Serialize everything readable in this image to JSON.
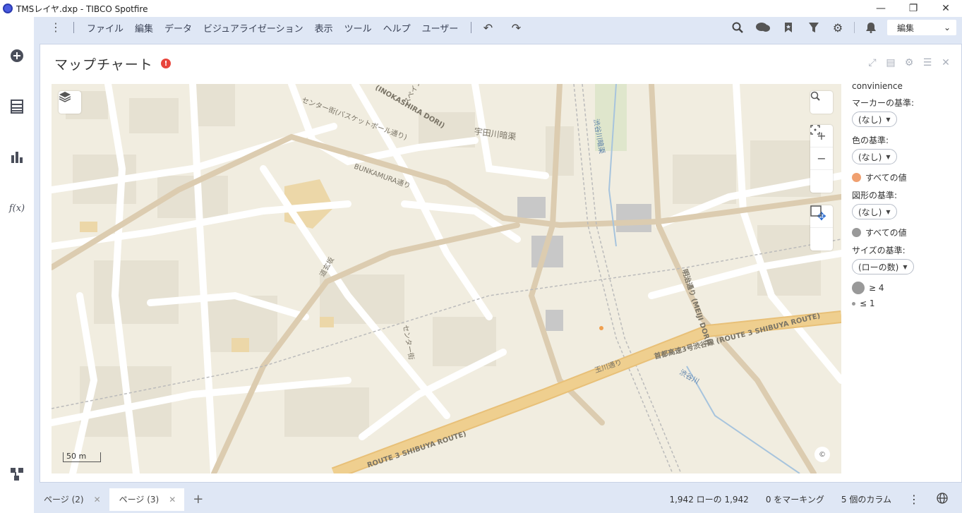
{
  "window": {
    "title": "TMSレイヤ.dxp - TIBCO Spotfire",
    "controls": {
      "minimize": "—",
      "restore": "❐",
      "close": "✕"
    }
  },
  "menubar": {
    "items": [
      "ファイル",
      "編集",
      "データ",
      "ビジュアライゼーション",
      "表示",
      "ツール",
      "ヘルプ",
      "ユーザー"
    ],
    "mode": "編集"
  },
  "visualization": {
    "title": "マップチャート",
    "warning": "!"
  },
  "map": {
    "scale_label": "50 m",
    "copyright": "©",
    "labels": [
      {
        "text": "宇田川暗渠"
      },
      {
        "text": "(INOKASHIRA DORI)"
      },
      {
        "text": "センター街(バスケットボール通り)"
      },
      {
        "text": "BUNKAMURA通り"
      },
      {
        "text": "明治通り (MEIJI DORI)"
      },
      {
        "text": "玉川通り"
      },
      {
        "text": "首都高速3号渋谷線 (ROUTE 3 SHIBUYA ROUTE)"
      },
      {
        "text": "ROUTE 3 SHIBUYA ROUTE)"
      },
      {
        "text": "渋谷川"
      },
      {
        "text": "道玄坂"
      },
      {
        "text": "センター街"
      },
      {
        "text": "渋谷川暗渠"
      },
      {
        "text": "スペイン坂"
      }
    ],
    "marker_color": "#f0a050"
  },
  "legend": {
    "title": "convinience",
    "marker_by_label": "マーカーの基準:",
    "marker_by_value": "(なし)",
    "color_by_label": "色の基準:",
    "color_by_value": "(なし)",
    "color_item": "すべての値",
    "color_item_color": "#f0a070",
    "shape_by_label": "図形の基準:",
    "shape_by_value": "(なし)",
    "shape_item": "すべての値",
    "shape_item_color": "#999999",
    "size_by_label": "サイズの基準:",
    "size_by_value": "(ローの数)",
    "size_max": "≥ 4",
    "size_min": "≤ 1"
  },
  "pages": [
    {
      "label": "ページ (2)",
      "active": false
    },
    {
      "label": "ページ (3)",
      "active": true
    }
  ],
  "status": {
    "rows": "1,942 ローの 1,942",
    "marked": "0 をマーキング",
    "columns": "5 個のカラム"
  }
}
